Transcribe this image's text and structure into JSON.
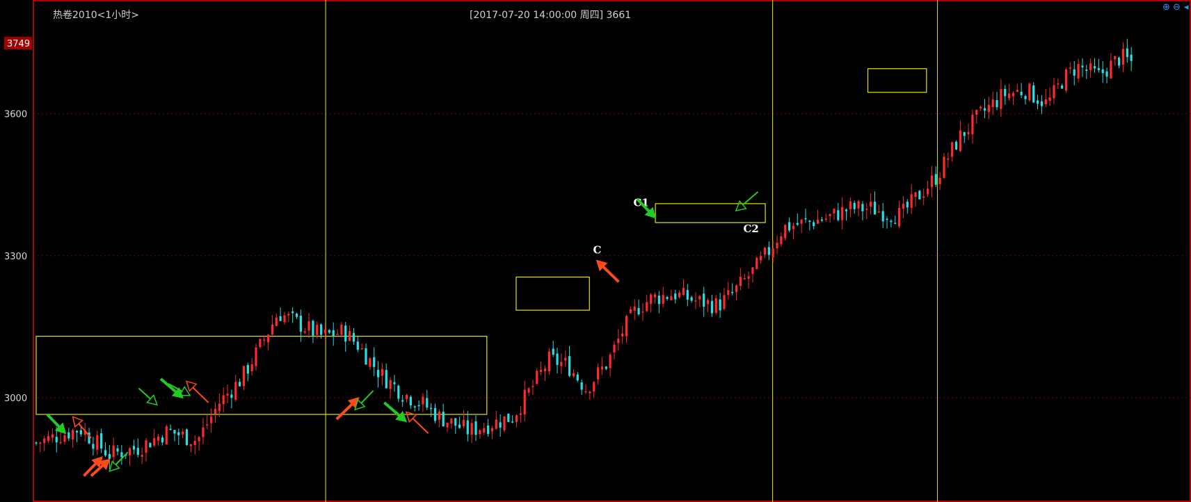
{
  "header": {
    "title": "热卷2010<1小时>",
    "crosshair_info": "[2017-07-20  14:00:00 周四]    3661"
  },
  "toolbar": {
    "zoom_in_icon": "zoom-in-icon",
    "zoom_out_icon": "zoom-out-icon",
    "scroll_left_icon": "arrow-left-icon"
  },
  "chart_data": {
    "type": "candlestick",
    "title": "热卷2010<1小时>",
    "ylim": [
      2780,
      3840
    ],
    "yticks": [
      3000,
      3300,
      3600
    ],
    "ymax_label": "3749",
    "grid": "dotted-horizontal",
    "colors": {
      "up": "#ff2a2a",
      "down": "#26e0e6",
      "frame": "#b00000",
      "box": "#e6e600",
      "arrow_red": "#ff4a1a",
      "arrow_green": "#22cc22"
    },
    "candle_count": 270,
    "price_path": [
      [
        0,
        2905
      ],
      [
        12,
        2935
      ],
      [
        20,
        2880
      ],
      [
        28,
        2895
      ],
      [
        36,
        2930
      ],
      [
        44,
        2910
      ],
      [
        50,
        2990
      ],
      [
        56,
        3040
      ],
      [
        62,
        3120
      ],
      [
        66,
        3180
      ],
      [
        72,
        3155
      ],
      [
        78,
        3130
      ],
      [
        84,
        3140
      ],
      [
        88,
        3110
      ],
      [
        94,
        3050
      ],
      [
        100,
        3010
      ],
      [
        106,
        2985
      ],
      [
        110,
        2960
      ],
      [
        118,
        2930
      ],
      [
        124,
        2945
      ],
      [
        130,
        2960
      ],
      [
        136,
        3030
      ],
      [
        140,
        3080
      ],
      [
        145,
        3070
      ],
      [
        150,
        3020
      ],
      [
        156,
        3075
      ],
      [
        160,
        3140
      ],
      [
        164,
        3190
      ],
      [
        168,
        3210
      ],
      [
        174,
        3220
      ],
      [
        180,
        3205
      ],
      [
        186,
        3195
      ],
      [
        190,
        3220
      ],
      [
        196,
        3270
      ],
      [
        200,
        3310
      ],
      [
        204,
        3360
      ],
      [
        210,
        3370
      ],
      [
        216,
        3380
      ],
      [
        222,
        3400
      ],
      [
        228,
        3400
      ],
      [
        232,
        3390
      ],
      [
        236,
        3385
      ],
      [
        240,
        3420
      ],
      [
        246,
        3470
      ],
      [
        252,
        3550
      ],
      [
        258,
        3600
      ],
      [
        264,
        3640
      ],
      [
        270,
        3650
      ],
      [
        276,
        3620
      ],
      [
        280,
        3670
      ],
      [
        284,
        3700
      ],
      [
        290,
        3680
      ],
      [
        296,
        3720
      ],
      [
        300,
        3705
      ]
    ],
    "vertical_lines_at": [
      79,
      201,
      246
    ],
    "boxes": [
      {
        "x": [
          0,
          123
        ],
        "y": [
          2965,
          3130
        ]
      },
      {
        "x": [
          131,
          151
        ],
        "y": [
          3185,
          3255
        ]
      },
      {
        "x": [
          169,
          199
        ],
        "y": [
          3370,
          3410
        ]
      },
      {
        "x": [
          227,
          243
        ],
        "y": [
          3645,
          3695
        ]
      }
    ],
    "annotations": [
      {
        "text": "C",
        "x": 152,
        "y": 3305
      },
      {
        "text": "C1",
        "x": 163,
        "y": 3405
      },
      {
        "text": "C2",
        "x": 193,
        "y": 3350
      }
    ],
    "arrows": [
      {
        "color": "green",
        "style": "solid",
        "from": [
          3,
          2965
        ],
        "to": [
          8,
          2925
        ]
      },
      {
        "color": "red",
        "style": "outline",
        "from": [
          15,
          2915
        ],
        "to": [
          10,
          2960
        ]
      },
      {
        "color": "red",
        "style": "solid",
        "from": [
          13,
          2835
        ],
        "to": [
          18,
          2875
        ]
      },
      {
        "color": "red",
        "style": "solid",
        "from": [
          15,
          2835
        ],
        "to": [
          20,
          2870
        ]
      },
      {
        "color": "green",
        "style": "outline",
        "from": [
          25,
          2885
        ],
        "to": [
          20,
          2845
        ]
      },
      {
        "color": "green",
        "style": "outline",
        "from": [
          28,
          3020
        ],
        "to": [
          33,
          2985
        ]
      },
      {
        "color": "green",
        "style": "solid",
        "from": [
          34,
          3040
        ],
        "to": [
          40,
          3000
        ]
      },
      {
        "color": "green",
        "style": "outline",
        "from": [
          36,
          3030
        ],
        "to": [
          42,
          3005
        ]
      },
      {
        "color": "red",
        "style": "outline",
        "from": [
          47,
          2990
        ],
        "to": [
          41,
          3035
        ]
      },
      {
        "color": "red",
        "style": "solid",
        "from": [
          82,
          2955
        ],
        "to": [
          88,
          3000
        ]
      },
      {
        "color": "green",
        "style": "outline",
        "from": [
          92,
          3015
        ],
        "to": [
          87,
          2975
        ]
      },
      {
        "color": "green",
        "style": "solid",
        "from": [
          95,
          2990
        ],
        "to": [
          101,
          2950
        ]
      },
      {
        "color": "red",
        "style": "outline",
        "from": [
          107,
          2925
        ],
        "to": [
          101,
          2970
        ]
      },
      {
        "color": "red",
        "style": "solid",
        "from": [
          159,
          3245
        ],
        "to": [
          153,
          3290
        ]
      },
      {
        "color": "green",
        "style": "solid",
        "from": [
          164,
          3420
        ],
        "to": [
          169,
          3380
        ]
      },
      {
        "color": "green",
        "style": "outline",
        "from": [
          197,
          3435
        ],
        "to": [
          191,
          3395
        ]
      }
    ]
  }
}
